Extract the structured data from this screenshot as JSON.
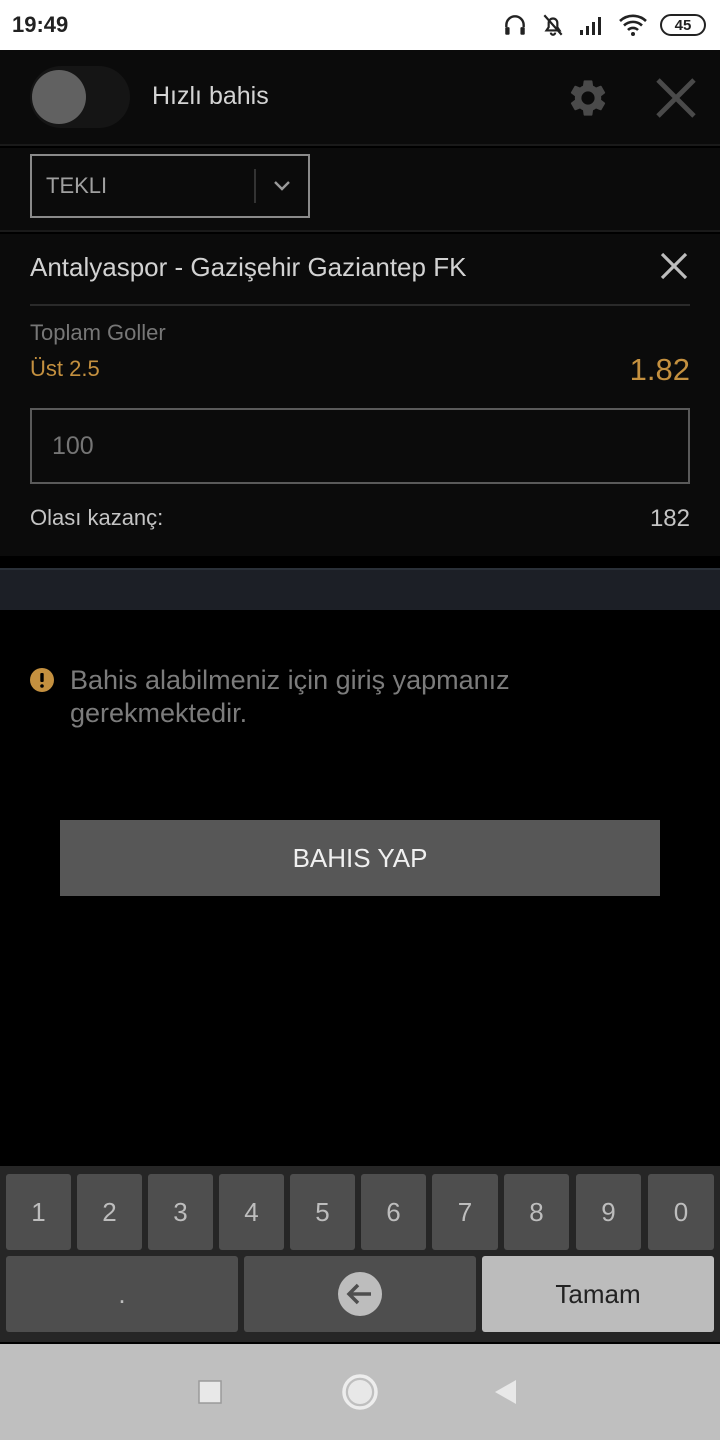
{
  "status_bar": {
    "time": "19:49",
    "battery": "45",
    "icons": [
      "headphones-icon",
      "bell-off-icon",
      "signal-icon",
      "wifi-icon",
      "battery-icon"
    ]
  },
  "header": {
    "quick_bet_label": "Hızlı bahis",
    "quick_bet_enabled": false,
    "icons": [
      "gear-icon",
      "close-icon"
    ]
  },
  "bet_type": {
    "selected": "TEKLI"
  },
  "selection": {
    "event": "Antalyaspor - Gazişehir Gaziantep FK",
    "market": "Toplam Goller",
    "outcome": "Üst 2.5",
    "odds": "1.82",
    "stake_placeholder": "100",
    "potential_win_label": "Olası kazanç:",
    "potential_win_value": "182"
  },
  "warning": {
    "text": "Bahis alabilmeniz için giriş yapmanız gerekmektedir."
  },
  "place_bet_label": "BAHIS YAP",
  "keypad": {
    "digits": [
      "1",
      "2",
      "3",
      "4",
      "5",
      "6",
      "7",
      "8",
      "9",
      "0"
    ],
    "decimal": ".",
    "confirm": "Tamam"
  },
  "colors": {
    "accent": "#c4903f",
    "background": "#0b0b0b",
    "button": "#575757"
  }
}
